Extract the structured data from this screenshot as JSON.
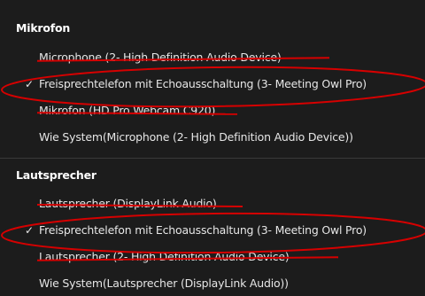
{
  "colors": {
    "background": "#1c1c1c",
    "text": "#e6e6e6",
    "header": "#ffffff",
    "annotation": "#d60000"
  },
  "icons": {
    "check": "checkmark-icon"
  },
  "microphone_section": {
    "header": "Mikrofon",
    "items": [
      {
        "label": "Microphone (2- High Definition Audio Device)",
        "selected": false,
        "check": ""
      },
      {
        "label": "Freisprechtelefon mit Echoausschaltung (3- Meeting Owl Pro)",
        "selected": true,
        "check": "✓"
      },
      {
        "label": "Mikrofon (HD Pro Webcam C920)",
        "selected": false,
        "check": ""
      },
      {
        "label": "Wie System(Microphone (2- High Definition Audio Device))",
        "selected": false,
        "check": ""
      }
    ]
  },
  "speaker_section": {
    "header": "Lautsprecher",
    "items": [
      {
        "label": "Lautsprecher (DisplayLink Audio)",
        "selected": false,
        "check": ""
      },
      {
        "label": "Freisprechtelefon mit Echoausschaltung (3- Meeting Owl Pro)",
        "selected": true,
        "check": "✓"
      },
      {
        "label": "Lautsprecher (2- High Definition Audio Device)",
        "selected": false,
        "check": ""
      },
      {
        "label": "Wie System(Lautsprecher (DisplayLink Audio))",
        "selected": false,
        "check": ""
      }
    ]
  }
}
